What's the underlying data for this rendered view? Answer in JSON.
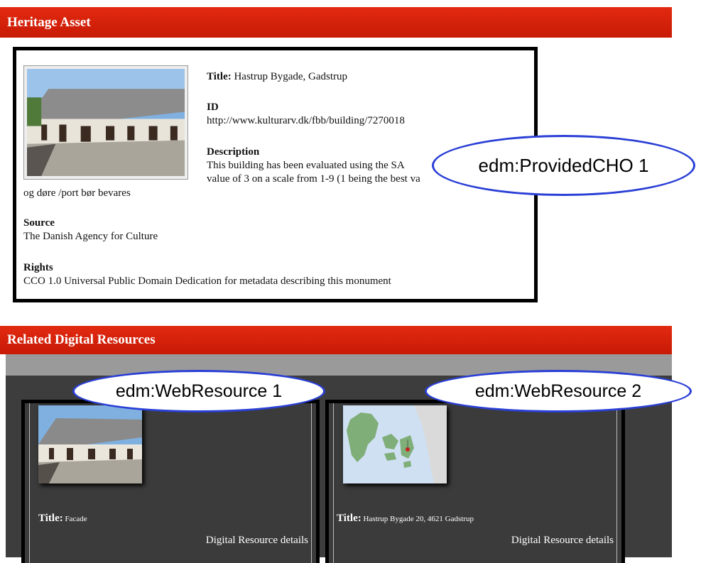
{
  "heritage": {
    "header": "Heritage Asset",
    "title_label": "Title:",
    "title_value": "Hastrup Bygade, Gadstrup",
    "id_label": "ID",
    "id_value": "http://www.kulturarv.dk/fbb/building/7270018",
    "description_label": "Description",
    "description_line1": "This building has been evaluated using the SA",
    "description_line2": "value of 3 on a scale from 1-9 (1 being the best va",
    "description_line3": "og døre /port bør bevares",
    "source_label": "Source",
    "source_value": "The Danish Agency for Culture",
    "rights_label": "Rights",
    "rights_value": "CCO 1.0 Universal Public Domain Dedication for metadata describing this monument"
  },
  "annotations": {
    "cho": "edm:ProvidedCHO 1",
    "web1": "edm:WebResource 1",
    "web2": "edm:WebResource 2"
  },
  "related": {
    "header": "Related Digital Resources",
    "resources": [
      {
        "title_label": "Title:",
        "title_value": "Facade",
        "details_link": "Digital Resource details"
      },
      {
        "title_label": "Title:",
        "title_value": "Hastrup Bygade 20, 4621 Gadstrup",
        "details_link": "Digital Resource details"
      }
    ]
  },
  "colors": {
    "header_red": "#d0200a",
    "ellipse_border": "#2a3fd6",
    "panel_dark": "#3d3d3d"
  }
}
